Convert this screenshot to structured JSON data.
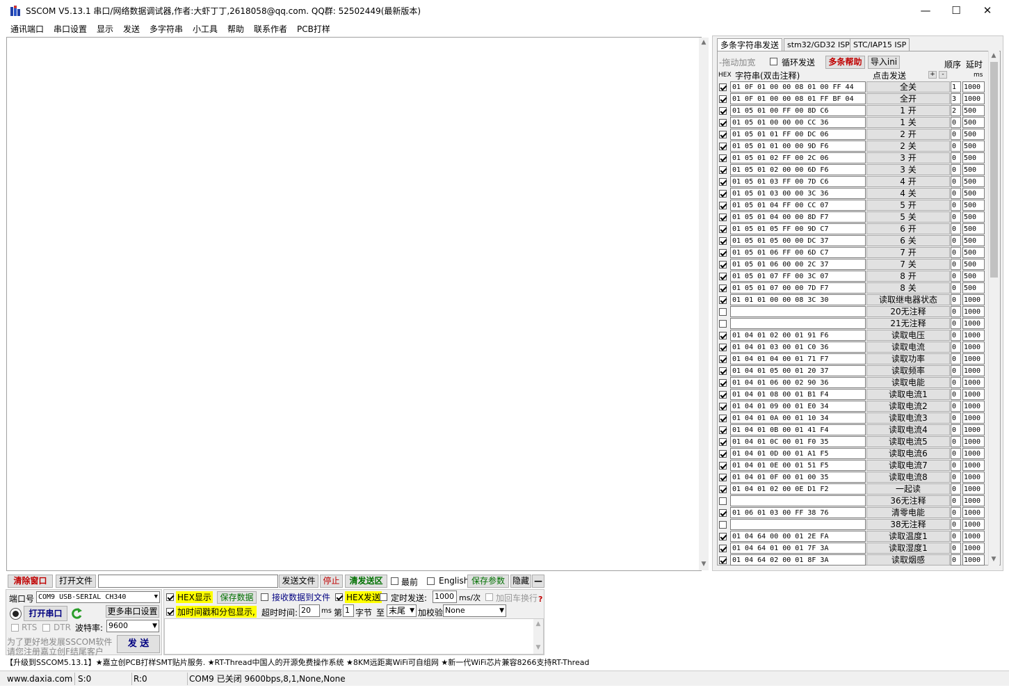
{
  "window": {
    "title": "SSCOM V5.13.1 串口/网络数据调试器,作者:大虾丁丁,2618058@qq.com. QQ群: 52502449(最新版本)",
    "minimize_glyph": "—",
    "maximize_glyph": "☐",
    "close_glyph": "✕"
  },
  "menu": [
    "通讯端口",
    "串口设置",
    "显示",
    "发送",
    "多字符串",
    "小工具",
    "帮助",
    "联系作者",
    "PCB打样"
  ],
  "right_panel": {
    "tabs": [
      "多条字符串发送",
      "stm32/GD32 ISP",
      "STC/IAP15 ISP"
    ],
    "toolbar": {
      "drag_widen": "-拖动加宽",
      "loop_send": "循环发送",
      "help": "多条帮助",
      "import_ini": "导入ini",
      "order": "顺序",
      "delay": "延时"
    },
    "headers": {
      "hex": "HEX",
      "string": "字符串(双击注释)",
      "click_send": "点击发送",
      "plus": "+",
      "minus": "-",
      "ms": "ms"
    },
    "rows": [
      {
        "checked": true,
        "hex": "01 0F 01 00 00 08 01 00 FF 44",
        "label": "全关",
        "order": "1",
        "delay": "1000"
      },
      {
        "checked": true,
        "hex": "01 0F 01 00 00 08 01 FF BF 04",
        "label": "全开",
        "order": "3",
        "delay": "1000"
      },
      {
        "checked": true,
        "hex": "01 05 01 00 FF 00 8D C6",
        "label": "1 开",
        "order": "2",
        "delay": "500"
      },
      {
        "checked": true,
        "hex": "01 05 01 00 00 00 CC 36",
        "label": "1 关",
        "order": "0",
        "delay": "500"
      },
      {
        "checked": true,
        "hex": "01 05 01 01 FF 00 DC 06",
        "label": "2 开",
        "order": "0",
        "delay": "500"
      },
      {
        "checked": true,
        "hex": "01 05 01 01 00 00 9D F6",
        "label": "2 关",
        "order": "0",
        "delay": "500"
      },
      {
        "checked": true,
        "hex": "01 05 01 02 FF 00 2C 06",
        "label": "3 开",
        "order": "0",
        "delay": "500"
      },
      {
        "checked": true,
        "hex": "01 05 01 02 00 00 6D F6",
        "label": "3 关",
        "order": "0",
        "delay": "500"
      },
      {
        "checked": true,
        "hex": "01 05 01 03 FF 00 7D C6",
        "label": "4 开",
        "order": "0",
        "delay": "500"
      },
      {
        "checked": true,
        "hex": "01 05 01 03 00 00 3C 36",
        "label": "4 关",
        "order": "0",
        "delay": "500"
      },
      {
        "checked": true,
        "hex": "01 05 01 04 FF 00 CC 07",
        "label": "5 开",
        "order": "0",
        "delay": "500"
      },
      {
        "checked": true,
        "hex": "01 05 01 04 00 00 8D F7",
        "label": "5 关",
        "order": "0",
        "delay": "500"
      },
      {
        "checked": true,
        "hex": "01 05 01 05 FF 00 9D C7",
        "label": "6 开",
        "order": "0",
        "delay": "500"
      },
      {
        "checked": true,
        "hex": "01 05 01 05 00 00 DC 37",
        "label": "6 关",
        "order": "0",
        "delay": "500"
      },
      {
        "checked": true,
        "hex": "01 05 01 06 FF 00 6D C7",
        "label": "7 开",
        "order": "0",
        "delay": "500"
      },
      {
        "checked": true,
        "hex": "01 05 01 06 00 00 2C 37",
        "label": "7 关",
        "order": "0",
        "delay": "500"
      },
      {
        "checked": true,
        "hex": "01 05 01 07 FF 00 3C 07",
        "label": "8 开",
        "order": "0",
        "delay": "500"
      },
      {
        "checked": true,
        "hex": "01 05 01 07 00 00 7D F7",
        "label": "8 关",
        "order": "0",
        "delay": "500"
      },
      {
        "checked": true,
        "hex": "01 01 01 00 00 08 3C 30",
        "label": "读取继电器状态",
        "order": "0",
        "delay": "1000"
      },
      {
        "checked": false,
        "hex": "",
        "label": "20无注释",
        "order": "0",
        "delay": "1000"
      },
      {
        "checked": false,
        "hex": "",
        "label": "21无注释",
        "order": "0",
        "delay": "1000"
      },
      {
        "checked": true,
        "hex": "01 04 01 02 00 01 91 F6",
        "label": "读取电压",
        "order": "0",
        "delay": "1000"
      },
      {
        "checked": true,
        "hex": "01 04 01 03 00 01 C0 36",
        "label": "读取电流",
        "order": "0",
        "delay": "1000"
      },
      {
        "checked": true,
        "hex": "01 04 01 04 00 01 71 F7",
        "label": "读取功率",
        "order": "0",
        "delay": "1000"
      },
      {
        "checked": true,
        "hex": "01 04 01 05 00 01 20 37",
        "label": "读取频率",
        "order": "0",
        "delay": "1000"
      },
      {
        "checked": true,
        "hex": "01 04 01 06 00 02 90 36",
        "label": "读取电能",
        "order": "0",
        "delay": "1000"
      },
      {
        "checked": true,
        "hex": "01 04 01 08 00 01 B1 F4",
        "label": "读取电流1",
        "order": "0",
        "delay": "1000"
      },
      {
        "checked": true,
        "hex": "01 04 01 09 00 01 E0 34",
        "label": "读取电流2",
        "order": "0",
        "delay": "1000"
      },
      {
        "checked": true,
        "hex": "01 04 01 0A 00 01 10 34",
        "label": "读取电流3",
        "order": "0",
        "delay": "1000"
      },
      {
        "checked": true,
        "hex": "01 04 01 0B 00 01 41 F4",
        "label": "读取电流4",
        "order": "0",
        "delay": "1000"
      },
      {
        "checked": true,
        "hex": "01 04 01 0C 00 01 F0 35",
        "label": "读取电流5",
        "order": "0",
        "delay": "1000"
      },
      {
        "checked": true,
        "hex": "01 04 01 0D 00 01 A1 F5",
        "label": "读取电流6",
        "order": "0",
        "delay": "1000"
      },
      {
        "checked": true,
        "hex": "01 04 01 0E 00 01 51 F5",
        "label": "读取电流7",
        "order": "0",
        "delay": "1000"
      },
      {
        "checked": true,
        "hex": "01 04 01 0F 00 01 00 35",
        "label": "读取电流8",
        "order": "0",
        "delay": "1000"
      },
      {
        "checked": true,
        "hex": "01 04 01 02 00 0E D1 F2",
        "label": "一起读",
        "order": "0",
        "delay": "1000"
      },
      {
        "checked": false,
        "hex": "",
        "label": "36无注释",
        "order": "0",
        "delay": "1000"
      },
      {
        "checked": true,
        "hex": "01 06 01 03 00 FF 38 76",
        "label": "清零电能",
        "order": "0",
        "delay": "1000"
      },
      {
        "checked": false,
        "hex": "",
        "label": "38无注释",
        "order": "0",
        "delay": "1000"
      },
      {
        "checked": true,
        "hex": "01 04 64 00 00 01 2E FA",
        "label": "读取温度1",
        "order": "0",
        "delay": "1000"
      },
      {
        "checked": true,
        "hex": "01 04 64 01 00 01 7F 3A",
        "label": "读取湿度1",
        "order": "0",
        "delay": "1000"
      },
      {
        "checked": true,
        "hex": "01 04 64 02 00 01 8F 3A",
        "label": "读取烟感",
        "order": "0",
        "delay": "1000"
      }
    ]
  },
  "toolbar": {
    "clear_window": "清除窗口",
    "open_file": "打开文件",
    "file_path": "",
    "send_file": "发送文件",
    "stop": "停止",
    "clear_send": "清发送区",
    "topmost": "最前",
    "english": "English",
    "save_params": "保存参数",
    "hide": "隐藏",
    "collapse": "—"
  },
  "port": {
    "port_label": "端口号",
    "port_value": "COM9 USB-SERIAL CH340",
    "open_port": "打开串口",
    "more_settings": "更多串口设置",
    "rts": "RTS",
    "dtr": "DTR",
    "baud_label": "波特率:",
    "baud_value": "9600",
    "promo_1": "为了更好地发展SSCOM软件",
    "promo_2": "请您注册嘉立创F结尾客户"
  },
  "options": {
    "hex_display": "HEX显示",
    "save_data": "保存数据",
    "recv_to_file": "接收数据到文件",
    "hex_send": "HEX发送",
    "timed_send": "定时发送:",
    "interval_value": "1000",
    "interval_unit": "ms/次",
    "add_crlf": "加回车换行",
    "help_q": "?",
    "timestamp": "加时间戳和分包显示,",
    "timeout_label": "超时时间:",
    "timeout_value": "20",
    "timeout_unit": "ms",
    "byte_prefix": "第",
    "byte_index": "1",
    "byte_label": "字节",
    "to_label": "至",
    "to_value": "末尾",
    "checksum_label": "加校验",
    "checksum_value": "None",
    "send_button": "发 送"
  },
  "ticker": "【升级到SSCOM5.13.1】★嘉立创PCB打样SMT贴片服务. ★RT-Thread中国人的开源免费操作系统 ★8KM远距离WiFi可自组网 ★新一代WiFi芯片兼容8266支持RT-Thread",
  "status": {
    "website": "www.daxia.com",
    "sent": "S:0",
    "received": "R:0",
    "port_status": "COM9 已关闭  9600bps,8,1,None,None"
  },
  "colors": {
    "highlight_yellow": "#ffff00",
    "red_text": "#c00000",
    "green_text": "#007000",
    "blue_text": "#000080"
  }
}
